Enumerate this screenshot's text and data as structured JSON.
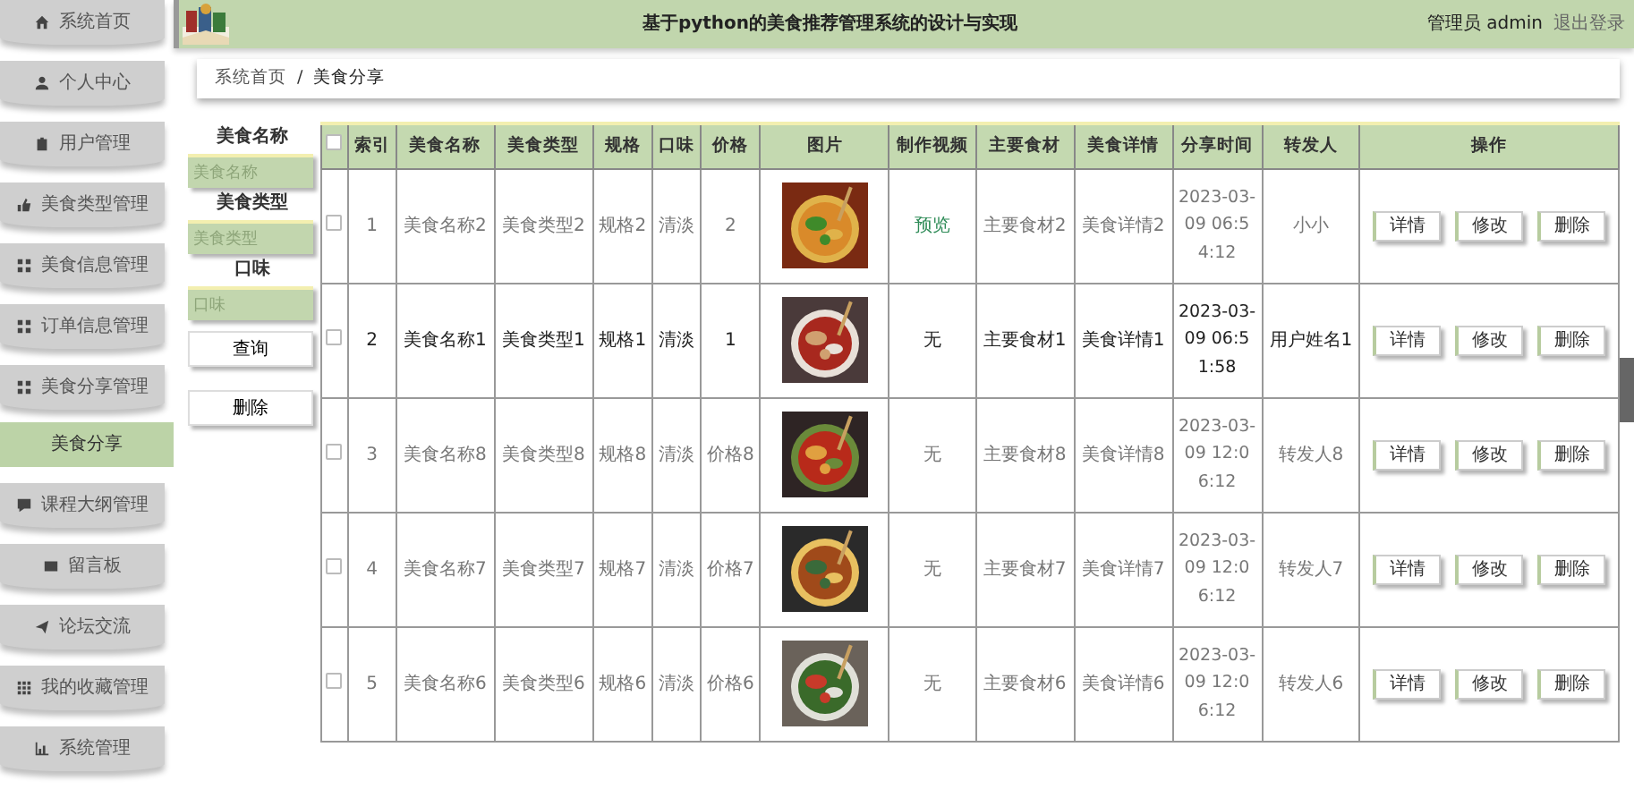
{
  "sidebar": {
    "items": [
      {
        "label": "系统首页",
        "kind": "menu",
        "selected": false
      },
      {
        "label": "个人中心",
        "kind": "menu",
        "selected": false
      },
      {
        "label": "用户管理",
        "kind": "menu",
        "selected": false
      },
      {
        "label": "美食类型管理",
        "kind": "menu",
        "selected": false
      },
      {
        "label": "美食信息管理",
        "kind": "menu",
        "selected": false
      },
      {
        "label": "订单信息管理",
        "kind": "menu",
        "selected": false
      },
      {
        "label": "美食分享管理",
        "kind": "menu",
        "selected": false
      },
      {
        "label": "美食分享",
        "kind": "submenu",
        "selected": true
      },
      {
        "label": "课程大纲管理",
        "kind": "menu",
        "selected": false
      },
      {
        "label": "留言板",
        "kind": "menu",
        "selected": false
      },
      {
        "label": "论坛交流",
        "kind": "menu",
        "selected": false
      },
      {
        "label": "我的收藏管理",
        "kind": "menu",
        "selected": false
      },
      {
        "label": "系统管理",
        "kind": "menu",
        "selected": false
      }
    ]
  },
  "header": {
    "title": "基于python的美食推荐管理系统的设计与实现",
    "user": "管理员 admin",
    "logout": "退出登录"
  },
  "breadcrumb": {
    "items": [
      "系统首页",
      "美食分享"
    ],
    "separator": "/"
  },
  "search": {
    "fields": [
      {
        "label": "美食名称",
        "placeholder": "美食名称"
      },
      {
        "label": "美食类型",
        "placeholder": "美食类型"
      },
      {
        "label": "口味",
        "placeholder": "口味"
      }
    ],
    "buttons": [
      "查询",
      "删除"
    ]
  },
  "table": {
    "columns": [
      "索引",
      "美食名称",
      "美食类型",
      "规格",
      "口味",
      "价格",
      "图片",
      "制作视频",
      "主要食材",
      "美食详情",
      "分享时间",
      "转发人",
      "操作"
    ],
    "select_all_checked": false,
    "rows": [
      {
        "index": "1",
        "name": "美食名称2",
        "type": "美食类型2",
        "spec": "规格2",
        "taste": "清淡",
        "price": "2",
        "video": "预览",
        "link": true,
        "ingredient": "主要食材2",
        "detail": "美食详情2",
        "time": "2023-03-09 06:54:12",
        "forwarder": "小小",
        "checked": false,
        "highlighted": false,
        "actions": [
          "详情",
          "修改",
          "删除"
        ]
      },
      {
        "index": "2",
        "name": "美食名称1",
        "type": "美食类型1",
        "spec": "规格1",
        "taste": "清淡",
        "price": "1",
        "video": "无",
        "link": false,
        "ingredient": "主要食材1",
        "detail": "美食详情1",
        "time": "2023-03-09 06:51:58",
        "forwarder": "用户姓名1",
        "checked": false,
        "highlighted": true,
        "actions": [
          "详情",
          "修改",
          "删除"
        ]
      },
      {
        "index": "3",
        "name": "美食名称8",
        "type": "美食类型8",
        "spec": "规格8",
        "taste": "清淡",
        "price": "价格8",
        "video": "无",
        "link": false,
        "ingredient": "主要食材8",
        "detail": "美食详情8",
        "time": "2023-03-09 12:06:12",
        "forwarder": "转发人8",
        "checked": false,
        "highlighted": false,
        "actions": [
          "详情",
          "修改",
          "删除"
        ]
      },
      {
        "index": "4",
        "name": "美食名称7",
        "type": "美食类型7",
        "spec": "规格7",
        "taste": "清淡",
        "price": "价格7",
        "video": "无",
        "link": false,
        "ingredient": "主要食材7",
        "detail": "美食详情7",
        "time": "2023-03-09 12:06:12",
        "forwarder": "转发人7",
        "checked": false,
        "highlighted": false,
        "actions": [
          "详情",
          "修改",
          "删除"
        ]
      },
      {
        "index": "5",
        "name": "美食名称6",
        "type": "美食类型6",
        "spec": "规格6",
        "taste": "清淡",
        "price": "价格6",
        "video": "无",
        "link": false,
        "ingredient": "主要食材6",
        "detail": "美食详情6",
        "time": "2023-03-09 12:06:12",
        "forwarder": "转发人6",
        "checked": false,
        "highlighted": false,
        "actions": [
          "详情",
          "修改",
          "删除"
        ]
      }
    ]
  }
}
